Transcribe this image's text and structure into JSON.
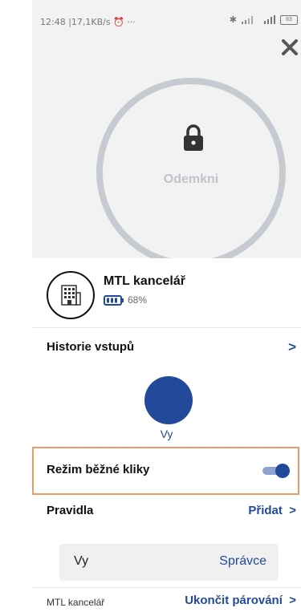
{
  "status_bar": {
    "time": "12:48",
    "speed": "17,1KB/s",
    "more": "···",
    "battery": "63"
  },
  "lock": {
    "label": "Odemkni"
  },
  "device": {
    "name": "MTL kancelář",
    "battery_percent": "68%"
  },
  "history": {
    "title": "Historie vstupů",
    "user_label": "Vy"
  },
  "mode": {
    "title": "Režim běžné kliky",
    "enabled": true
  },
  "rules": {
    "title": "Pravidla",
    "add_label": "Přidat",
    "items": [
      {
        "user": "Vy",
        "role": "Správce"
      }
    ]
  },
  "pairing": {
    "device": "MTL kancelář",
    "end_label": "Ukončit párování"
  },
  "colors": {
    "accent": "#234a9a",
    "ring": "#c6cbd2",
    "highlight_border": "#e89a6a"
  }
}
